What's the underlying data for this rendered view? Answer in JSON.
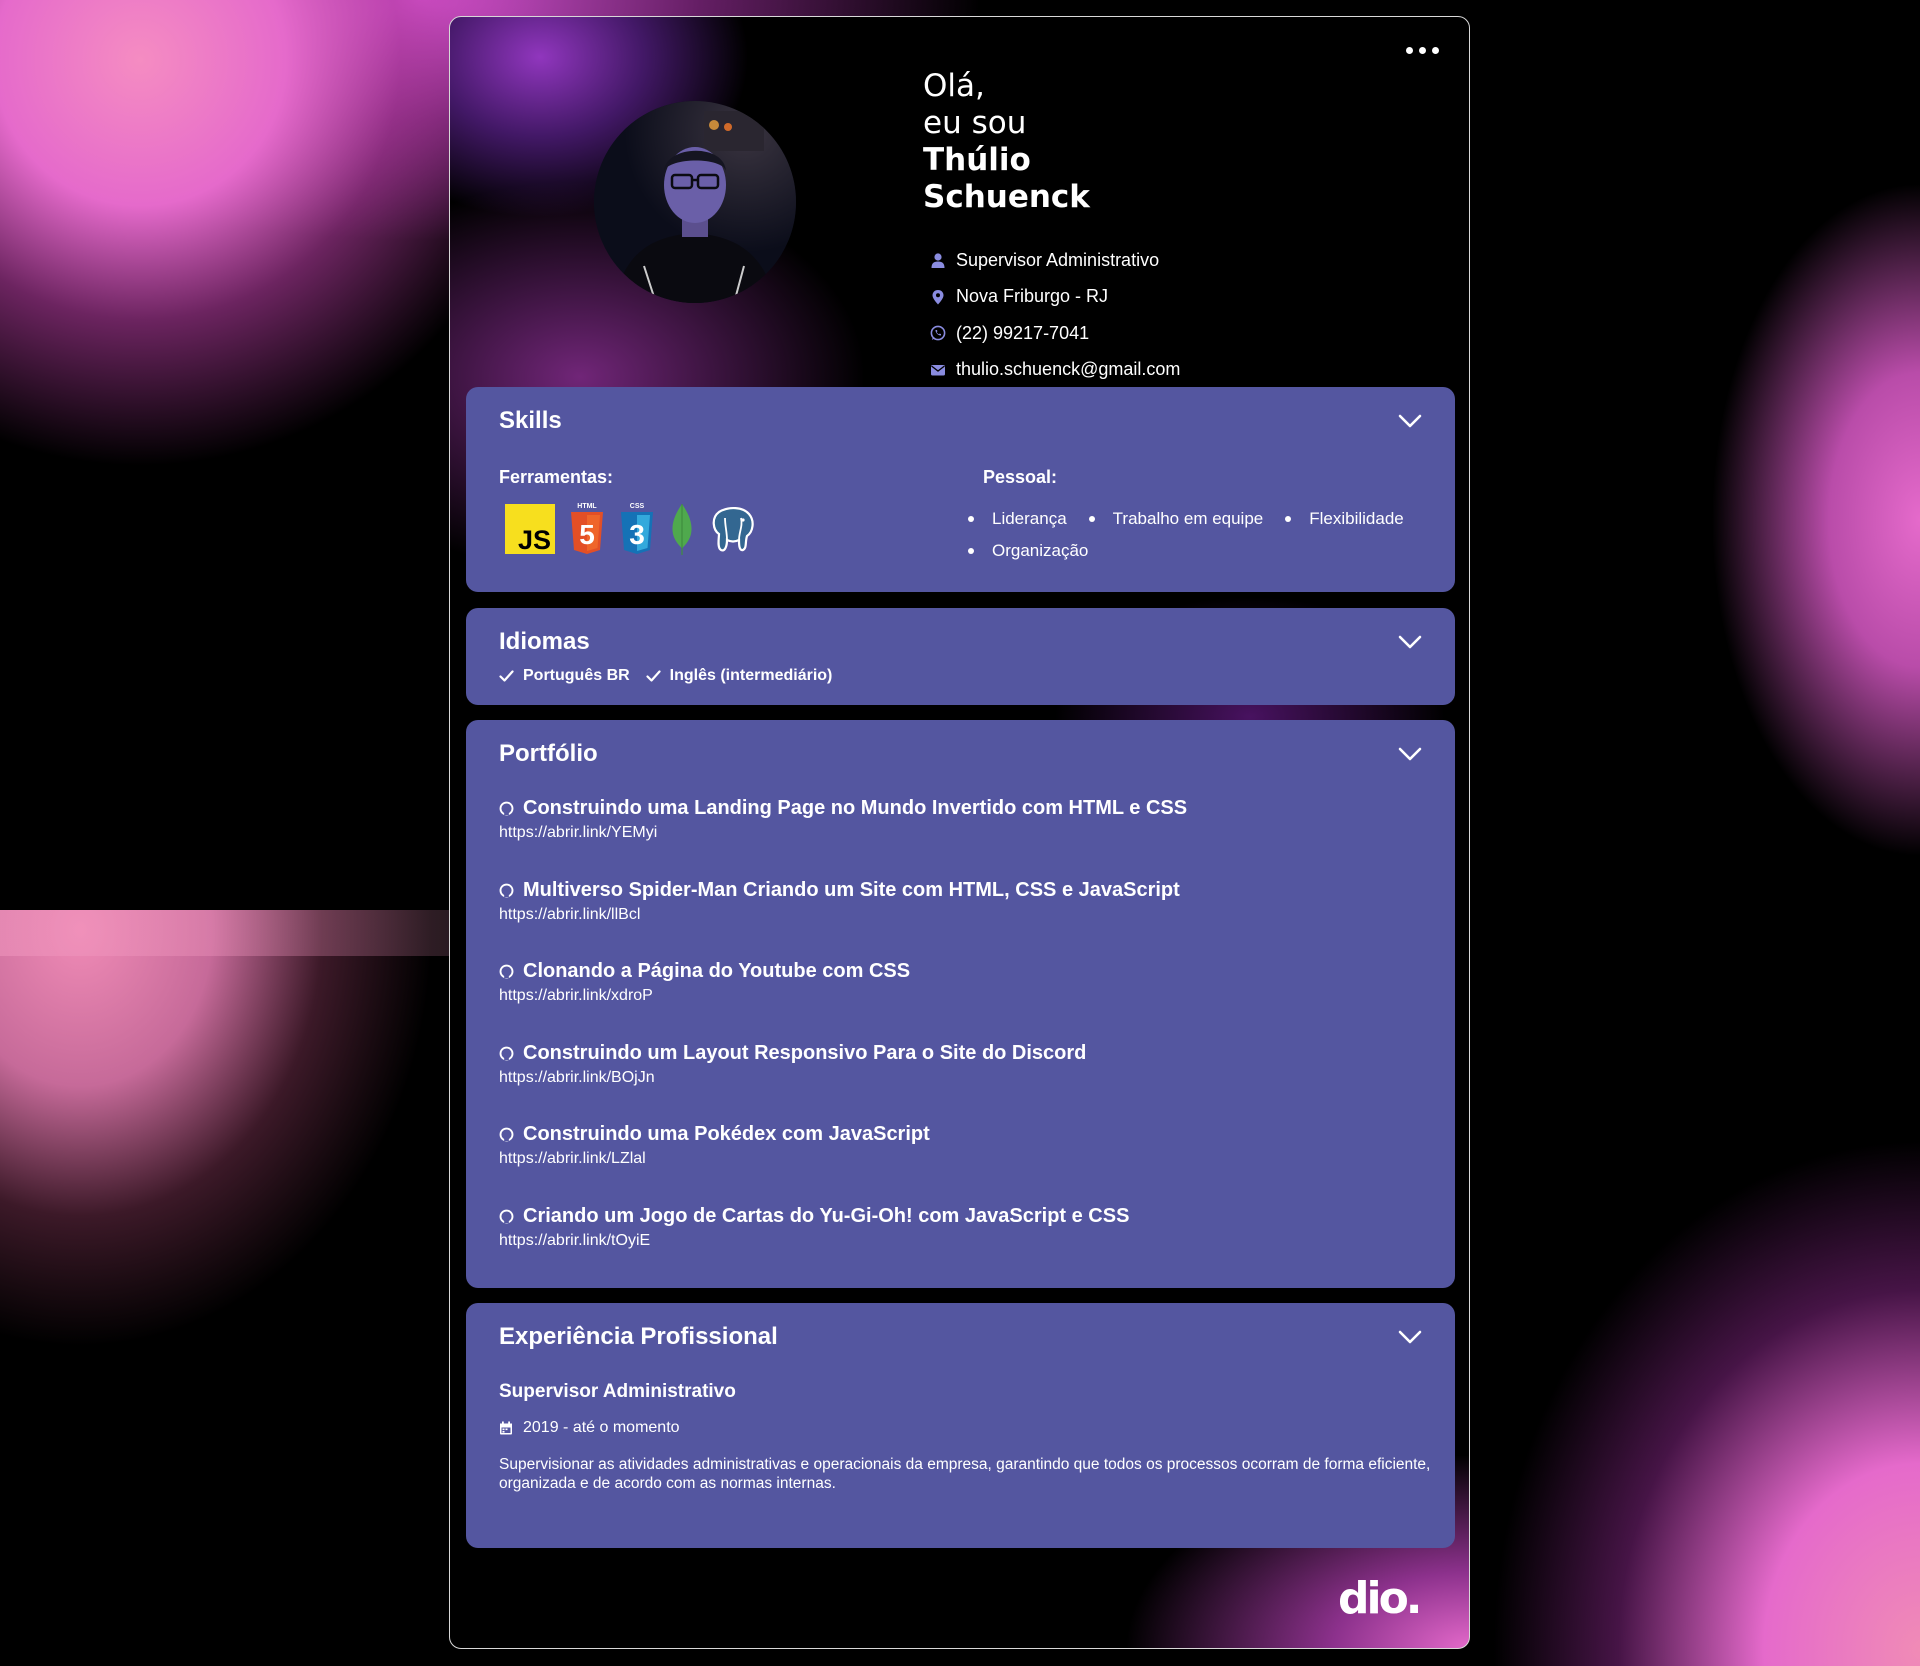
{
  "profile": {
    "greeting_line1": "Olá,",
    "greeting_line2": "eu sou",
    "first_name": "Thúlio",
    "last_name": "Schuenck",
    "job": "Supervisor Administrativo",
    "location": "Nova Friburgo - RJ",
    "phone": "(22) 99217-7041",
    "email": "thulio.schuenck@gmail.com"
  },
  "skills": {
    "title": "Skills",
    "tools_label": "Ferramentas:",
    "tools": [
      "JavaScript",
      "HTML5",
      "CSS3",
      "MongoDB",
      "PostgreSQL"
    ],
    "tool_badges": {
      "js": "JS",
      "html": "HTML",
      "css": "CSS",
      "html_num": "5",
      "css_num": "3"
    },
    "personal_label": "Pessoal:",
    "personal": [
      "Liderança",
      "Trabalho em equipe",
      "Flexibilidade",
      "Organização"
    ]
  },
  "idiomas": {
    "title": "Idiomas",
    "languages": [
      "Português BR",
      "Inglês (intermediário)"
    ]
  },
  "portfolio": {
    "title": "Portfólio",
    "projects": [
      {
        "name": "Construindo uma Landing Page no Mundo Invertido com HTML e CSS",
        "url": "https://abrir.link/YEMyi"
      },
      {
        "name": "Multiverso Spider-Man Criando um Site com HTML, CSS e JavaScript",
        "url": "https://abrir.link/llBcl"
      },
      {
        "name": "Clonando a Página do Youtube com CSS",
        "url": "https://abrir.link/xdroP"
      },
      {
        "name": "Construindo um Layout Responsivo Para o Site do Discord",
        "url": "https://abrir.link/BOjJn"
      },
      {
        "name": "Construindo uma Pokédex com JavaScript",
        "url": "https://abrir.link/LZlal"
      },
      {
        "name": "Criando um Jogo de Cartas do Yu-Gi-Oh! com JavaScript e CSS",
        "url": "https://abrir.link/tOyiE"
      }
    ]
  },
  "experience": {
    "title": "Experiência Profissional",
    "jobs": [
      {
        "role": "Supervisor Administrativo",
        "period": "2019 - até o momento",
        "description": "Supervisionar as atividades administrativas e operacionais da empresa, garantindo que todos os processos ocorram de forma eficiente, organizada e de acordo com as normas internas."
      }
    ]
  },
  "brand": {
    "logo_text": "dio."
  },
  "colors": {
    "section_bg": "#5456a0",
    "icon_accent": "#8a8ce0",
    "js_yellow": "#f7df1e",
    "html_orange": "#e34f26",
    "css_blue": "#1572b6",
    "mongo_green": "#4fa94d"
  },
  "icons": [
    "user-icon",
    "map-pin-icon",
    "whatsapp-icon",
    "mail-icon",
    "chevron-down-icon",
    "check-icon",
    "github-icon",
    "calendar-icon",
    "more-options-icon"
  ]
}
